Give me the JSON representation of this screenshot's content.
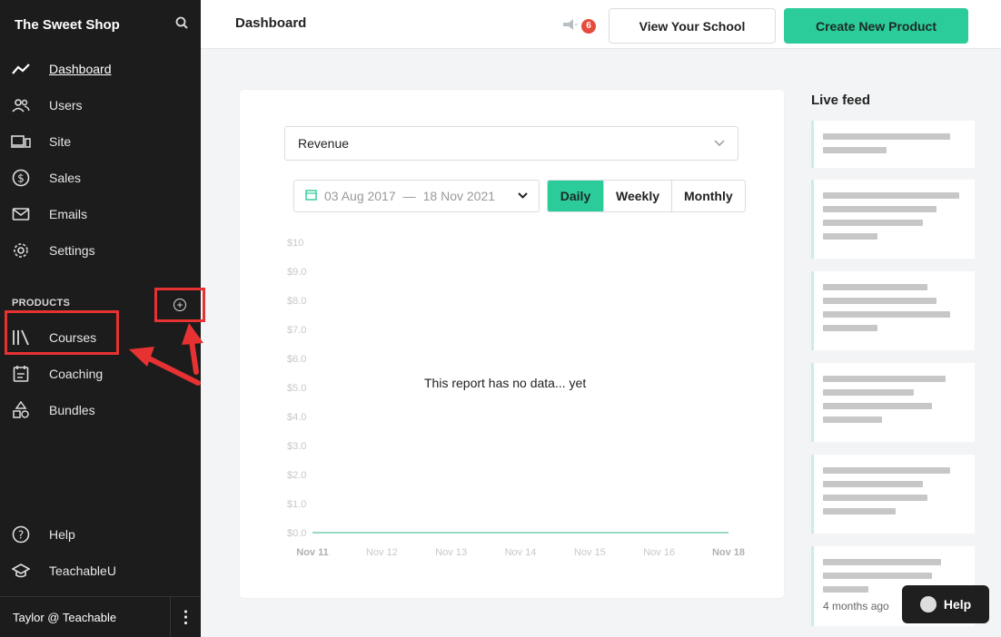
{
  "sidebar": {
    "brand": "The Sweet Shop",
    "nav": [
      {
        "label": "Dashboard",
        "icon": "trend-icon"
      },
      {
        "label": "Users",
        "icon": "users-icon"
      },
      {
        "label": "Site",
        "icon": "devices-icon"
      },
      {
        "label": "Sales",
        "icon": "dollar-icon"
      },
      {
        "label": "Emails",
        "icon": "mail-icon"
      },
      {
        "label": "Settings",
        "icon": "gear-icon"
      }
    ],
    "products_label": "PRODUCTS",
    "products": [
      {
        "label": "Courses",
        "icon": "library-icon"
      },
      {
        "label": "Coaching",
        "icon": "calendar-icon"
      },
      {
        "label": "Bundles",
        "icon": "shapes-icon"
      }
    ],
    "footer_nav": [
      {
        "label": "Help",
        "icon": "question-icon"
      },
      {
        "label": "TeachableU",
        "icon": "graduation-icon"
      }
    ],
    "user": "Taylor @ Teachable"
  },
  "topbar": {
    "title": "Dashboard",
    "notification_count": "6",
    "view_school": "View Your School",
    "create_product": "Create New Product"
  },
  "report": {
    "metric": "Revenue",
    "date_start": "03 Aug 2017",
    "date_sep": "—",
    "date_end": "18 Nov 2021",
    "periods": [
      "Daily",
      "Weekly",
      "Monthly"
    ],
    "active_period": "Daily",
    "empty_message": "This report has no data... yet"
  },
  "chart_data": {
    "type": "line",
    "x": [
      "Nov 11",
      "Nov 12",
      "Nov 13",
      "Nov 14",
      "Nov 15",
      "Nov 16",
      "Nov 18"
    ],
    "series": [
      {
        "values": [
          0,
          0,
          0,
          0,
          0,
          0,
          0
        ]
      }
    ],
    "y_ticks": [
      "$10",
      "$9.0",
      "$8.0",
      "$7.0",
      "$6.0",
      "$5.0",
      "$4.0",
      "$3.0",
      "$2.0",
      "$1.0",
      "$0.0"
    ],
    "ylim": [
      0,
      10
    ],
    "colors": {
      "line": "#9ad9c4"
    }
  },
  "live_feed": {
    "title": "Live feed",
    "last_time": "4 months ago"
  },
  "help_button": "Help",
  "colors": {
    "accent": "#2bcb9a",
    "sidebar": "#1c1c1c",
    "annotation": "#e63232"
  }
}
